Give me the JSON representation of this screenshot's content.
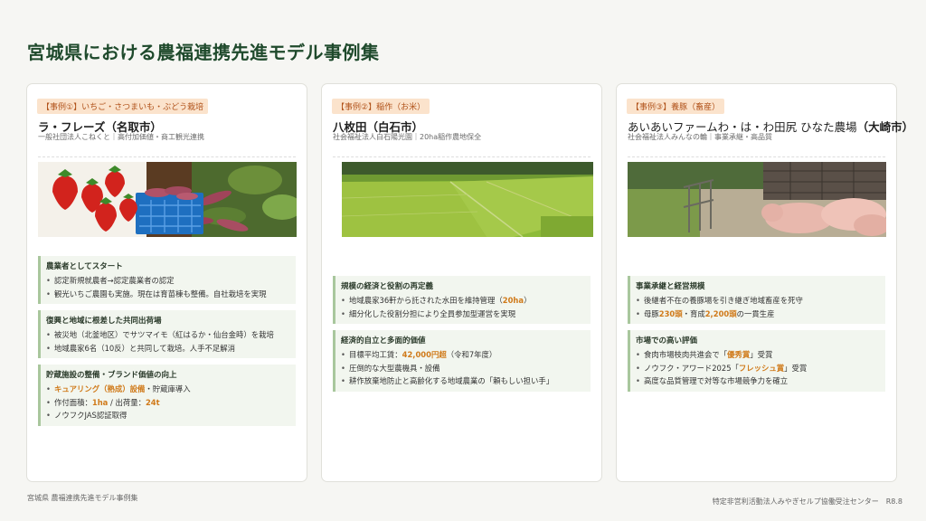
{
  "page_title": "宮城県における農福連携先進モデル事例集",
  "footer": {
    "left": "宮城県 農福連携先進モデル事例集",
    "right": "特定非営利活動法人みやぎセルプ協働受注センター　R8.8"
  },
  "cases": [
    {
      "tag": "【事例①】いちご・さつまいも・ぶどう栽培",
      "title_main": "ラ・フレーズ",
      "title_loc": "（名取市）",
      "subtitle": "一般社団法人こねくと｜高付加価値・商工観光連携",
      "photo": "strawberries-sweet-potatoes",
      "sections": [
        {
          "title": "農業者としてスタート",
          "items": [
            [
              "認定新規就農者→認定農業者の認定"
            ],
            [
              "観光いちご農園も実施。現在は育苗棟も整備。自社栽培を実現"
            ]
          ]
        },
        {
          "title": "復興と地域に根差した共同出荷場",
          "items": [
            [
              "被災地（北釜地区）でサツマイモ（紅はるか・仙台金時）を栽培"
            ],
            [
              "地域農家6名（10反）と共同して栽培。人手不足解消"
            ]
          ]
        },
        {
          "title": "貯蔵施設の整備・ブランド価値の向上",
          "items": [
            [
              "キュアリング（熟成）設備",
              "・貯蔵庫導入"
            ],
            [
              "作付面積：",
              "1ha",
              " / 出荷量：",
              "24t"
            ],
            [
              "ノウフクJAS認証取得"
            ]
          ]
        }
      ]
    },
    {
      "tag": "【事例②】稲作（お米）",
      "title_main": "八枚田（白石市）",
      "title_loc": "",
      "subtitle": "社会福祉法人白石陽光園｜20ha稲作農地保全",
      "photo": "rice-paddies",
      "sections": [
        {
          "title": "規模の経済と役割の再定義",
          "items": [
            [
              "地域農家36軒から託された水田を維持管理（",
              "20ha",
              "）"
            ],
            [
              "細分化した役割分担により全員参加型運営を実現"
            ]
          ]
        },
        {
          "title": "経済的自立と多面的価値",
          "items": [
            [
              "目標平均工賃：",
              "42,000円超",
              "（令和7年度）"
            ],
            [
              "圧倒的な大型農機具・設備"
            ],
            [
              "耕作放棄地防止と高齢化する地域農業の「頼もしい担い手」"
            ]
          ]
        }
      ]
    },
    {
      "tag": "【事例③】養豚（畜産）",
      "title_main": "あいあいファームわ・は・わ田尻 ひなた農場",
      "title_loc": "（大崎市）",
      "subtitle": "社会福祉法人みんなの輪｜事業承継・高品質",
      "photo": "pig-farm",
      "sections": [
        {
          "title": "事業承継と経営規模",
          "items": [
            [
              "後継者不在の養豚場を引き継ぎ地域畜産を死守"
            ],
            [
              "母豚",
              "230頭",
              "・育成",
              "2,200頭",
              "の一貫生産"
            ]
          ]
        },
        {
          "title": "市場での高い評価",
          "items": [
            [
              "食肉市場枝肉共進会で「",
              "優秀賞",
              "」受賞"
            ],
            [
              "ノウフク・アワード2025「",
              "フレッシュ賞",
              "」受賞"
            ],
            [
              "高度な品質管理で対等な市場競争力を確立"
            ]
          ]
        }
      ]
    }
  ]
}
